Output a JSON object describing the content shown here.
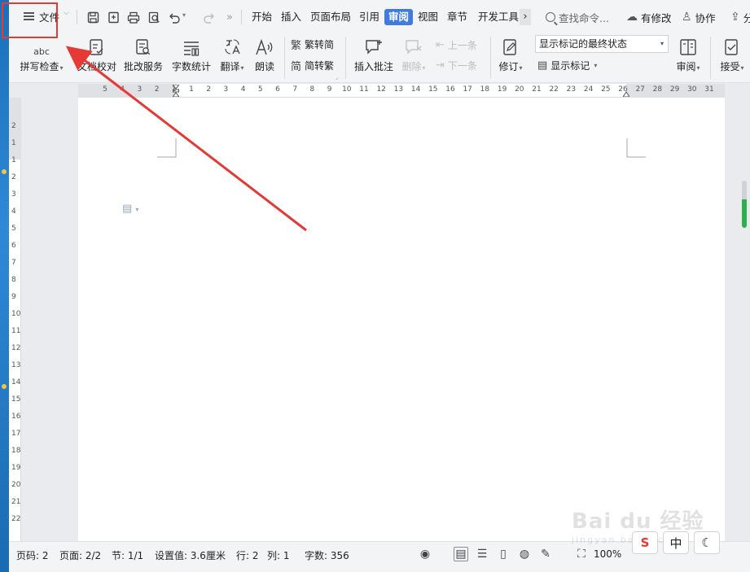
{
  "app": {
    "file_menu_label": "文件",
    "tabs": [
      "开始",
      "插入",
      "页面布局",
      "引用",
      "审阅",
      "视图",
      "章节",
      "开发工具"
    ],
    "active_tab": "审阅",
    "search_placeholder": "查找命令...",
    "right_actions": {
      "modified": "有修改",
      "collab": "协作",
      "share": "分"
    }
  },
  "ribbon": {
    "spell_check": "拼写检查",
    "proofread": "文档校对",
    "revision_service": "批改服务",
    "word_count": "字数统计",
    "translate": "翻译",
    "read_aloud": "朗读",
    "trad_to_simp": "繁转简",
    "simp_to_trad": "简转繁",
    "insert_comment": "插入批注",
    "delete": "删除",
    "prev": "上一条",
    "next": "下一条",
    "track_changes": "修订",
    "display_mode": "显示标记的最终状态",
    "show_markup": "显示标记",
    "review": "审阅",
    "accept": "接受",
    "abc_glyph": "abc"
  },
  "ruler": {
    "horizontal": [
      "5",
      "4",
      "3",
      "2",
      "1",
      "1",
      "2",
      "3",
      "4",
      "5",
      "6",
      "7",
      "8",
      "9",
      "10",
      "11",
      "12",
      "13",
      "14",
      "15",
      "16",
      "17",
      "18",
      "19",
      "20",
      "21",
      "22",
      "23",
      "24",
      "25",
      "26",
      "27",
      "28",
      "29",
      "30",
      "31"
    ],
    "vertical": [
      "2",
      "1",
      "1",
      "2",
      "3",
      "4",
      "5",
      "6",
      "7",
      "8",
      "9",
      "10",
      "11",
      "12",
      "13",
      "14",
      "15",
      "16",
      "17",
      "18",
      "19",
      "20",
      "21",
      "22"
    ]
  },
  "status": {
    "page_no": "页码: 2",
    "pages": "页面: 2/2",
    "section": "节: 1/1",
    "setting": "设置值: 3.6厘米",
    "row": "行: 2",
    "col": "列: 1",
    "word_count": "字数: 356",
    "zoom": "100%"
  },
  "ime": {
    "logo": "S",
    "mode": "中"
  },
  "watermark": {
    "brand": "Bai du 经验",
    "url": "jingyan.baidu.com"
  },
  "colors": {
    "accent": "#3f7be0",
    "highlight": "#e53935",
    "scroll_thumb": "#2bb24c"
  }
}
